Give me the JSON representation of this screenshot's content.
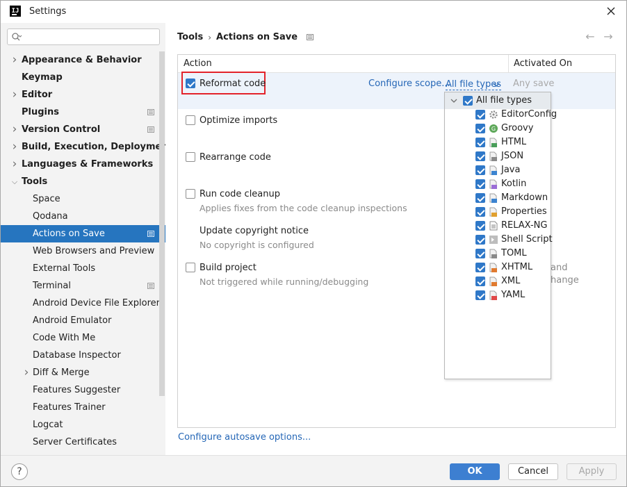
{
  "window": {
    "title": "Settings",
    "app_icon_text": "IJ"
  },
  "sidebar": {
    "search_placeholder": "",
    "items": [
      {
        "label": "Appearance & Behavior",
        "bold": true,
        "chevron": "right"
      },
      {
        "label": "Keymap",
        "bold": true,
        "chevron": ""
      },
      {
        "label": "Editor",
        "bold": true,
        "chevron": "right"
      },
      {
        "label": "Plugins",
        "bold": true,
        "chevron": "",
        "modified": true
      },
      {
        "label": "Version Control",
        "bold": true,
        "chevron": "right",
        "modified": true
      },
      {
        "label": "Build, Execution, Deployment",
        "bold": true,
        "chevron": "right"
      },
      {
        "label": "Languages & Frameworks",
        "bold": true,
        "chevron": "right"
      },
      {
        "label": "Tools",
        "bold": true,
        "chevron": "down"
      },
      {
        "label": "Space",
        "bold": false,
        "chevron": ""
      },
      {
        "label": "Qodana",
        "bold": false,
        "chevron": ""
      },
      {
        "label": "Actions on Save",
        "bold": false,
        "chevron": "",
        "selected": true,
        "modified": true
      },
      {
        "label": "Web Browsers and Preview",
        "bold": false,
        "chevron": ""
      },
      {
        "label": "External Tools",
        "bold": false,
        "chevron": ""
      },
      {
        "label": "Terminal",
        "bold": false,
        "chevron": "",
        "modified": true
      },
      {
        "label": "Android Device File Explorer",
        "bold": false,
        "chevron": ""
      },
      {
        "label": "Android Emulator",
        "bold": false,
        "chevron": ""
      },
      {
        "label": "Code With Me",
        "bold": false,
        "chevron": ""
      },
      {
        "label": "Database Inspector",
        "bold": false,
        "chevron": ""
      },
      {
        "label": "Diff & Merge",
        "bold": false,
        "chevron": "right"
      },
      {
        "label": "Features Suggester",
        "bold": false,
        "chevron": ""
      },
      {
        "label": "Features Trainer",
        "bold": false,
        "chevron": ""
      },
      {
        "label": "Logcat",
        "bold": false,
        "chevron": ""
      },
      {
        "label": "Server Certificates",
        "bold": false,
        "chevron": ""
      }
    ]
  },
  "breadcrumb": {
    "parent": "Tools",
    "separator": "›",
    "current": "Actions on Save"
  },
  "table": {
    "col_action": "Action",
    "col_activated": "Activated On"
  },
  "actions": {
    "reformat": {
      "label": "Reformat code",
      "checked": true,
      "configure_scope": "Configure scope...",
      "file_types": "All file types",
      "activated": "Any save"
    },
    "optimize": {
      "label": "Optimize imports",
      "checked": false
    },
    "rearrange": {
      "label": "Rearrange code",
      "checked": false
    },
    "cleanup": {
      "label": "Run code cleanup",
      "checked": false,
      "desc": "Applies fixes from the code cleanup inspections"
    },
    "copyright": {
      "label": "Update copyright notice",
      "desc": "No copyright is configured"
    },
    "build": {
      "label": "Build project",
      "checked": false,
      "desc": "Not triggered while running/debugging",
      "activated_partial_1": "and",
      "activated_partial_2": "hange"
    }
  },
  "file_types_popup": {
    "header": "All file types",
    "items": [
      {
        "label": "EditorConfig",
        "icon": "gear-icon",
        "checked": true
      },
      {
        "label": "Groovy",
        "icon": "groovy-icon",
        "checked": true
      },
      {
        "label": "HTML",
        "icon": "html-file-icon",
        "checked": true
      },
      {
        "label": "JSON",
        "icon": "json-file-icon",
        "checked": true
      },
      {
        "label": "Java",
        "icon": "java-file-icon",
        "checked": true
      },
      {
        "label": "Kotlin",
        "icon": "kotlin-file-icon",
        "checked": true
      },
      {
        "label": "Markdown",
        "icon": "markdown-file-icon",
        "checked": true
      },
      {
        "label": "Properties",
        "icon": "properties-file-icon",
        "checked": true
      },
      {
        "label": "RELAX-NG",
        "icon": "text-file-icon",
        "checked": true
      },
      {
        "label": "Shell Script",
        "icon": "shell-script-icon",
        "checked": true
      },
      {
        "label": "TOML",
        "icon": "toml-file-icon",
        "checked": true
      },
      {
        "label": "XHTML",
        "icon": "xhtml-file-icon",
        "checked": true
      },
      {
        "label": "XML",
        "icon": "xml-file-icon",
        "checked": true
      },
      {
        "label": "YAML",
        "icon": "yaml-file-icon",
        "checked": true
      }
    ]
  },
  "autosave_link": "Configure autosave options...",
  "footer": {
    "help": "?",
    "ok": "OK",
    "cancel": "Cancel",
    "apply": "Apply"
  },
  "colors": {
    "selection": "#2675bf",
    "accent": "#2f78c8",
    "link": "#2466b6",
    "highlight_box": "#e3222a"
  }
}
